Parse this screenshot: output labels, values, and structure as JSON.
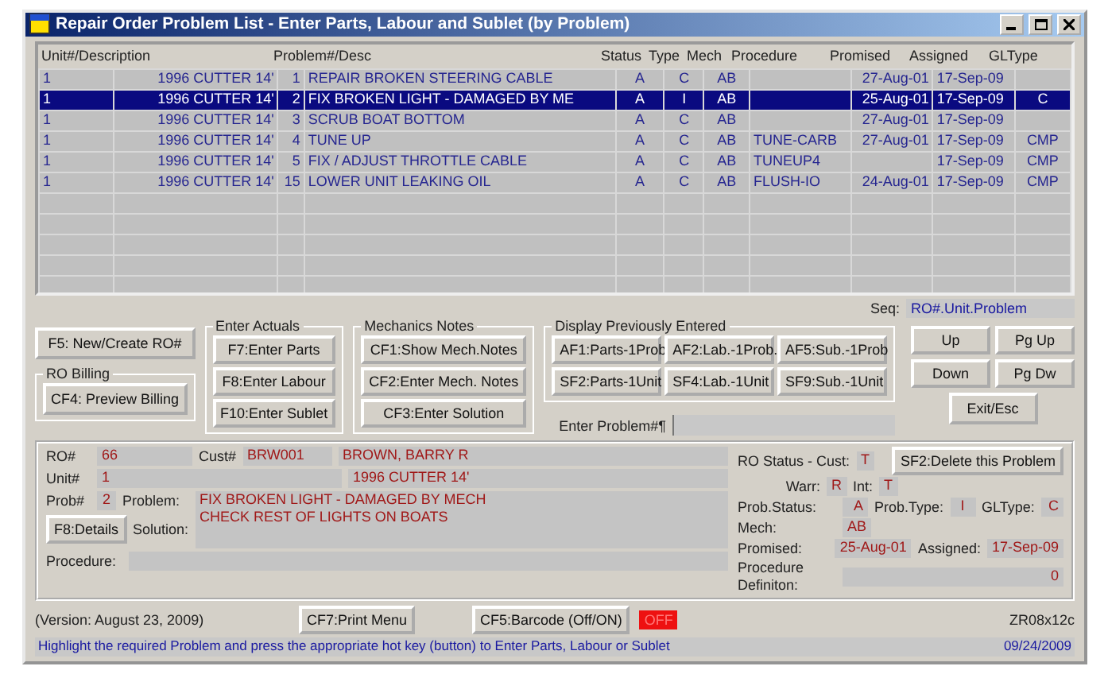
{
  "window": {
    "title": "Repair Order Problem List - Enter Parts, Labour and Sublet (by Problem)"
  },
  "table": {
    "columns": [
      "Unit#/Description",
      "",
      "Problem#/Desc",
      "",
      "Status",
      "Type",
      "Mech",
      "Procedure",
      "Promised",
      "Assigned",
      "GLType"
    ],
    "rows": [
      {
        "selected": false,
        "cells": [
          "1",
          "1996 CUTTER 14'",
          "1",
          "REPAIR BROKEN STEERING CABLE",
          "A",
          "C",
          "AB",
          "",
          "27-Aug-01",
          "17-Sep-09",
          ""
        ]
      },
      {
        "selected": true,
        "cells": [
          "1",
          "1996 CUTTER 14'",
          "2",
          "FIX BROKEN LIGHT - DAMAGED BY ME",
          "A",
          "I",
          "AB",
          "",
          "25-Aug-01",
          "17-Sep-09",
          "C"
        ]
      },
      {
        "selected": false,
        "cells": [
          "1",
          "1996 CUTTER 14'",
          "3",
          "SCRUB BOAT BOTTOM",
          "A",
          "C",
          "AB",
          "",
          "27-Aug-01",
          "17-Sep-09",
          ""
        ]
      },
      {
        "selected": false,
        "cells": [
          "1",
          "1996 CUTTER 14'",
          "4",
          "TUNE UP",
          "A",
          "C",
          "AB",
          "TUNE-CARB",
          "27-Aug-01",
          "17-Sep-09",
          "CMP"
        ]
      },
      {
        "selected": false,
        "cells": [
          "1",
          "1996 CUTTER 14'",
          "5",
          "FIX / ADJUST THROTTLE CABLE",
          "A",
          "C",
          "AB",
          "TUNEUP4",
          "",
          "17-Sep-09",
          "CMP"
        ]
      },
      {
        "selected": false,
        "cells": [
          "1",
          "1996 CUTTER 14'",
          "15",
          "LOWER UNIT LEAKING OIL",
          "A",
          "C",
          "AB",
          "FLUSH-IO",
          "24-Aug-01",
          "17-Sep-09",
          "CMP"
        ]
      }
    ]
  },
  "seq": {
    "label": "Seq:",
    "value": "RO#.Unit.Problem"
  },
  "new_button": "F5: New/Create RO#",
  "ro_billing": {
    "title": "RO Billing",
    "buttons": [
      "CF4: Preview Billing"
    ]
  },
  "enter_actuals": {
    "title": "Enter Actuals",
    "buttons": [
      "F7:Enter Parts",
      "F8:Enter Labour",
      "F10:Enter Sublet"
    ]
  },
  "mechanics_notes": {
    "title": "Mechanics Notes",
    "buttons": [
      "CF1:Show Mech.Notes",
      "CF2:Enter Mech. Notes",
      "CF3:Enter Solution"
    ]
  },
  "display_previously_entered": {
    "title": "Display Previously Entered",
    "buttons": [
      "AF1:Parts-1Prob",
      "AF2:Lab.-1Prob.",
      "AF5:Sub.-1Prob",
      "SF2:Parts-1Unit",
      "SF4:Lab.-1Unit",
      "SF9:Sub.-1Unit"
    ]
  },
  "enter_problem": {
    "label": "Enter Problem#¶"
  },
  "navigation": [
    "Up",
    "Pg Up",
    "Down",
    "Pg Dw",
    "Exit/Esc"
  ],
  "details": {
    "ro": {
      "label": "RO#",
      "value": "66"
    },
    "cust": {
      "label": "Cust#",
      "code": "BRW001",
      "name": "BROWN, BARRY R"
    },
    "unit": {
      "label": "Unit#",
      "value": "1",
      "description": "1996 CUTTER 14'"
    },
    "prob": {
      "label": "Prob#",
      "value": "2"
    },
    "problem": {
      "label": "Problem:",
      "lines": [
        "FIX BROKEN LIGHT - DAMAGED BY MECH",
        "CHECK REST OF LIGHTS ON BOATS"
      ]
    },
    "details_button": "F8:Details",
    "solution_label": "Solution:",
    "procedure_label": "Procedure:",
    "ro_status": {
      "label": "RO Status - Cust:",
      "value": "T"
    },
    "warr": {
      "label": "Warr:",
      "value": "R"
    },
    "int": {
      "label": "Int:",
      "value": "T"
    },
    "delete_button": "SF2:Delete this Problem",
    "prob_status": {
      "label": "Prob.Status:",
      "value": "A"
    },
    "prob_type": {
      "label": "Prob.Type:",
      "value": "I"
    },
    "gl_type": {
      "label": "GLType:",
      "value": "C"
    },
    "mech": {
      "label": "Mech:",
      "value": "AB"
    },
    "promised": {
      "label": "Promised:",
      "value": "25-Aug-01"
    },
    "assigned": {
      "label": "Assigned:",
      "value": "17-Sep-09"
    },
    "procedure_definition": {
      "label": "Procedure Definiton:",
      "value": "0"
    }
  },
  "footer": {
    "version": "(Version: August 23, 2009)",
    "print_button": "CF7:Print Menu",
    "barcode_button": "CF5:Barcode (Off/ON)",
    "barcode_state": "OFF",
    "barcode_on": false,
    "code": "ZR08x12c",
    "hint": "Highlight the required Problem and press the appropriate hot key (button) to Enter Parts, Labour or Sublet",
    "date": "09/24/2009"
  }
}
